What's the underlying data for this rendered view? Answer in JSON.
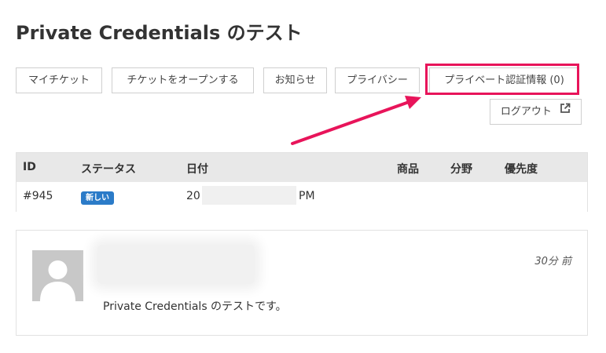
{
  "page": {
    "title": "Private Credentials のテスト"
  },
  "nav": {
    "my_tickets": "マイチケット",
    "open_ticket": "チケットをオープンする",
    "news": "お知らせ",
    "privacy": "プライバシー",
    "private_credentials": "プライベート認証情報 (0)",
    "logout": "ログアウト"
  },
  "table": {
    "headers": {
      "id": "ID",
      "status": "ステータス",
      "date": "日付",
      "product": "商品",
      "field": "分野",
      "priority": "優先度"
    },
    "rows": [
      {
        "id": "#945",
        "status": "新しい",
        "date_prefix": "20",
        "date_suffix": "PM"
      }
    ]
  },
  "comment": {
    "time": "30分 前",
    "body": "Private Credentials のテストです。"
  },
  "colors": {
    "highlight": "#e8145a",
    "badge": "#2b7bc8",
    "header_bg": "#e8e8e8"
  },
  "icons": {
    "logout": "external-link-icon",
    "avatar": "user-silhouette-icon"
  }
}
